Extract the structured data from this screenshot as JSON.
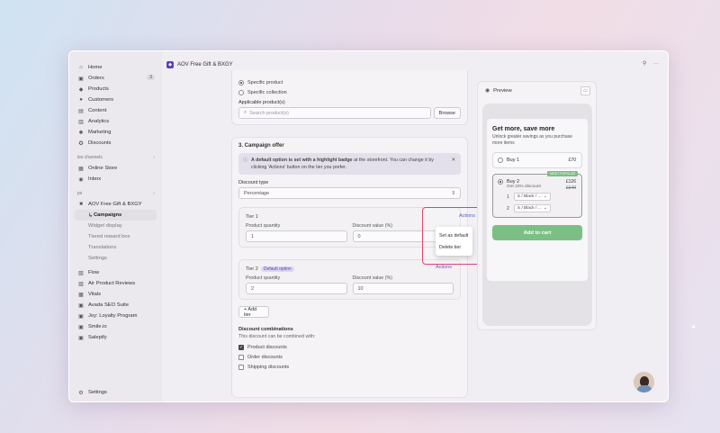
{
  "sidebar": {
    "items": [
      {
        "icon": "home-icon",
        "label": "Home"
      },
      {
        "icon": "orders-icon",
        "label": "Orders",
        "badge": "3"
      },
      {
        "icon": "tag-icon",
        "label": "Products"
      },
      {
        "icon": "person-icon",
        "label": "Customers"
      },
      {
        "icon": "content-icon",
        "label": "Content"
      },
      {
        "icon": "chart-icon",
        "label": "Analytics"
      },
      {
        "icon": "marketing-icon",
        "label": "Marketing"
      },
      {
        "icon": "discount-icon",
        "label": "Discounts"
      }
    ],
    "sales_channels_label": "les channels",
    "channels": [
      {
        "icon": "store-icon",
        "label": "Online Store"
      },
      {
        "icon": "inbox-icon",
        "label": "Inbox"
      }
    ],
    "apps_label": "ps",
    "app_name": "AOV Free Gift & BXGY",
    "app_subitems": [
      "Campaigns",
      "Widget display",
      "Tiered reward box",
      "Translations",
      "Settings"
    ],
    "other_apps": [
      {
        "icon": "flow-icon",
        "label": "Flow"
      },
      {
        "icon": "review-icon",
        "label": "Air Product Reviews"
      },
      {
        "icon": "vitals-icon",
        "label": "Vitals"
      },
      {
        "icon": "seo-icon",
        "label": "Avada SEO Suite"
      },
      {
        "icon": "loyalty-icon",
        "label": "Joy: Loyalty Program"
      },
      {
        "icon": "smile-icon",
        "label": "Smile.io"
      },
      {
        "icon": "salepify-icon",
        "label": "Salepify"
      }
    ],
    "settings_label": "Settings"
  },
  "topbar": {
    "title": "AOV Free Gift & BXGY"
  },
  "products_card": {
    "option_specific_product": "Specific product",
    "option_specific_collection": "Specific collection",
    "applicable_label": "Applicable product(s)",
    "search_placeholder": "Search product(s)",
    "browse_label": "Browse"
  },
  "offer_card": {
    "title": "3. Campaign offer",
    "banner_bold": "A default option is set with a highlight badge",
    "banner_rest": " at the storefront. You can change it by clicking 'Actions' button on the tier you prefer.",
    "discount_type_label": "Discount type",
    "discount_type_value": "Percentage",
    "tiers": [
      {
        "name": "Tier 1",
        "badge": "",
        "quantity": "1",
        "discount": "0"
      },
      {
        "name": "Tier 2",
        "badge": "Default option",
        "quantity": "2",
        "discount": "10"
      }
    ],
    "qty_label": "Product quantity",
    "discount_label": "Discount value (%)",
    "actions_label": "Actions",
    "add_tier_label": "+ Add tier"
  },
  "actions_menu": {
    "title": "Actions",
    "items": [
      "Set as default",
      "Delete tier"
    ]
  },
  "combinations": {
    "title": "Discount combinations",
    "subtitle": "This discount can be combined with:",
    "options": [
      {
        "label": "Product discounts",
        "checked": true
      },
      {
        "label": "Order discounts",
        "checked": false
      },
      {
        "label": "Shipping discounts",
        "checked": false
      }
    ]
  },
  "preview": {
    "title": "Preview",
    "offer_title": "Get more, save more",
    "offer_subtitle": "Unlock greater savings as you purchase more items",
    "buy1_label": "Buy 1",
    "buy1_price": "£70",
    "buy2_label": "Buy 2",
    "buy2_sub": "Get 10% discount",
    "buy2_price": "£126",
    "buy2_old": "£140",
    "ribbon": "MOST POPULAR",
    "variants": [
      {
        "num": "1",
        "value": "S / Black / ..."
      },
      {
        "num": "2",
        "value": "S / Black / ..."
      }
    ],
    "cart_label": "Add to cart"
  }
}
